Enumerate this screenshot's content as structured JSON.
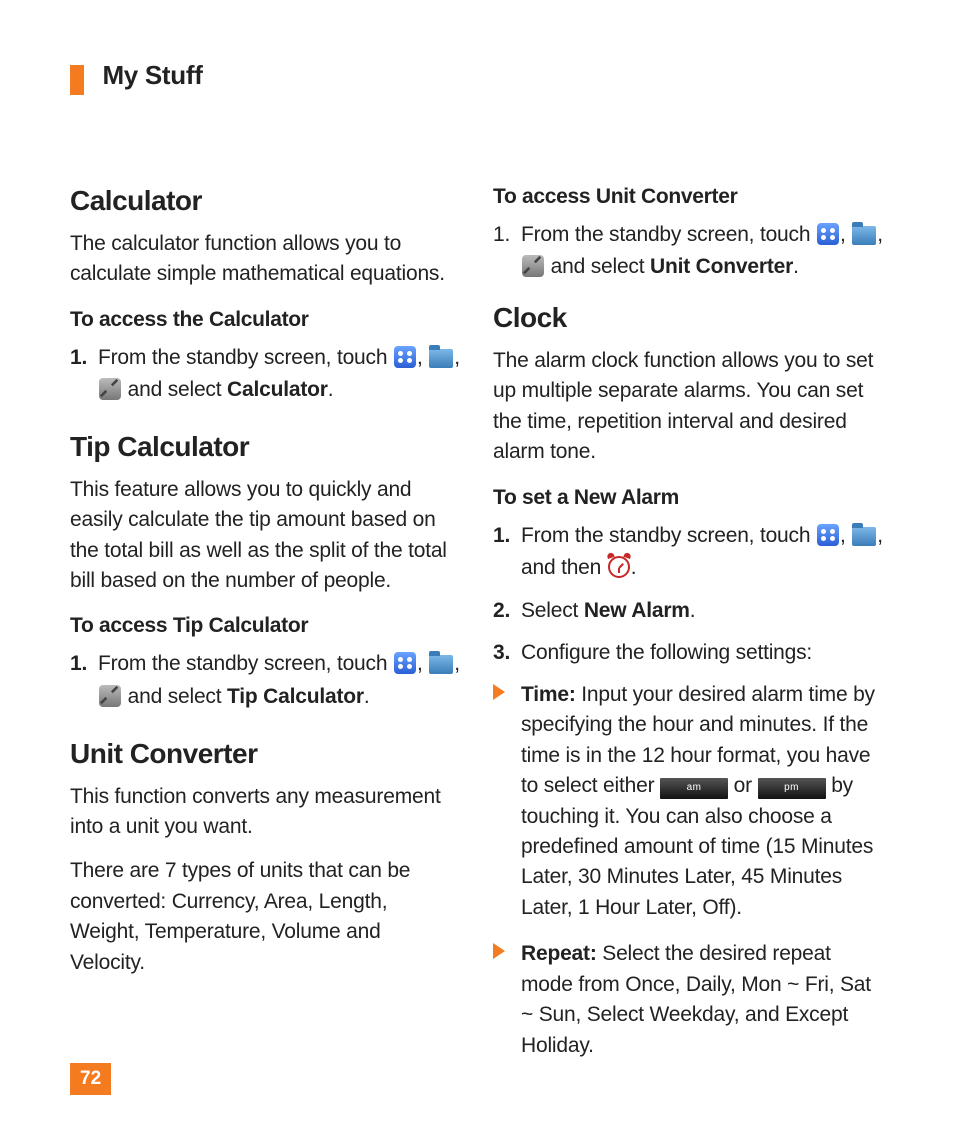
{
  "header": {
    "section": "My Stuff"
  },
  "page_number": "72",
  "left": {
    "calc": {
      "title": "Calculator",
      "desc": "The calculator function allows you to calculate simple mathematical equations.",
      "subhead": "To access the Calculator",
      "step1_num": "1.",
      "step1_pre": "From the standby screen, touch ",
      "sep1": ", ",
      "sep2": ", ",
      "step1_post1": " and select ",
      "step1_bold": "Calculator",
      "step1_post2": "."
    },
    "tip": {
      "title": "Tip Calculator",
      "desc": "This feature allows you to quickly and easily calculate the tip amount based on the total bill as well as the split of the total bill based on the number of people.",
      "subhead": "To access Tip Calculator",
      "step1_num": "1.",
      "step1_pre": "From the standby screen, touch ",
      "sep1": ", ",
      "sep2": ", ",
      "step1_post1": " and select ",
      "step1_bold": "Tip Calculator",
      "step1_post2": "."
    },
    "unit": {
      "title": "Unit Converter",
      "desc1": "This function converts any measurement into a unit you want.",
      "desc2": "There are 7 types of units that can be converted: Currency, Area, Length, Weight, Temperature, Volume and Velocity."
    }
  },
  "right": {
    "unit_access": {
      "subhead": "To access Unit Converter",
      "step1_num": "1.",
      "step1_pre": "From the standby screen, touch ",
      "sep1": ", ",
      "sep2": ", ",
      "step1_post1": " and select ",
      "step1_bold": "Unit Converter",
      "step1_post2": "."
    },
    "clock": {
      "title": "Clock",
      "desc": "The alarm clock function allows you to set up multiple separate alarms. You can set the time, repetition interval and desired alarm tone.",
      "subhead": "To set a New Alarm",
      "s1_num": "1.",
      "s1_pre": "From the standby screen, touch ",
      "s1_sep1": ", ",
      "s1_sep2": ", and then ",
      "s1_post": ".",
      "s2_num": "2.",
      "s2_pre": "Select ",
      "s2_bold": "New Alarm",
      "s2_post": ".",
      "s3_num": "3.",
      "s3_text": "Configure the following settings:",
      "b1_label": "Time:",
      "b1_pre": " Input your desired alarm time by specifying the hour and minutes. If the time is in the 12 hour format, you have to select either ",
      "am": "am",
      "b1_or": " or ",
      "pm": "pm",
      "b1_post": " by touching it. You can also choose a predefined amount of time (15 Minutes Later, 30 Minutes Later, 45 Minutes Later, 1 Hour Later, Off).",
      "b2_label": "Repeat:",
      "b2_text": " Select the desired repeat mode from Once, Daily, Mon ~ Fri, Sat ~ Sun, Select Weekday, and Except Holiday."
    }
  }
}
